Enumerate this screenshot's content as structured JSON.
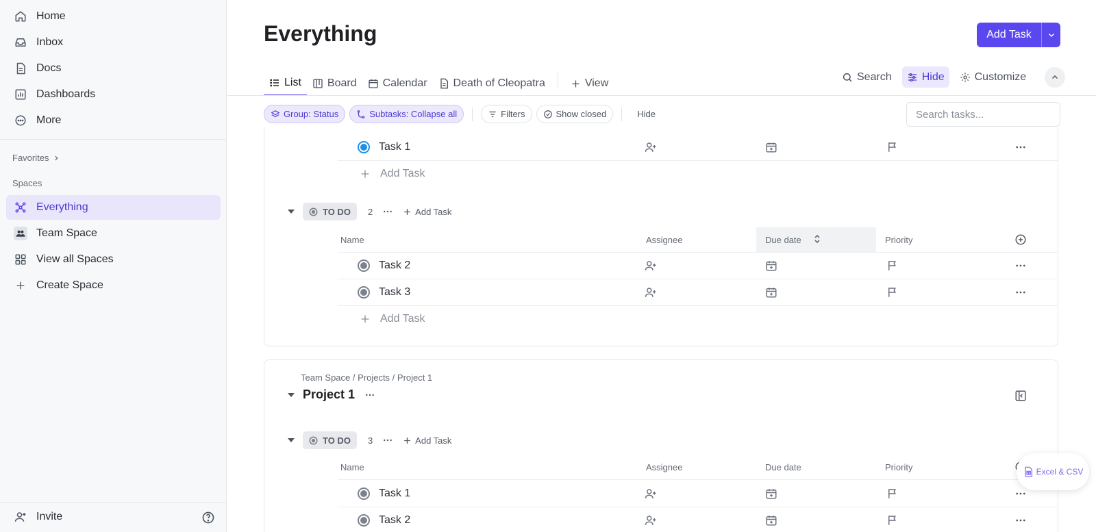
{
  "sidebar": {
    "nav": [
      {
        "label": "Home",
        "icon": "home-icon"
      },
      {
        "label": "Inbox",
        "icon": "inbox-icon"
      },
      {
        "label": "Docs",
        "icon": "docs-icon"
      },
      {
        "label": "Dashboards",
        "icon": "dashboards-icon"
      },
      {
        "label": "More",
        "icon": "more-circle-icon"
      }
    ],
    "favorites_label": "Favorites",
    "spaces_label": "Spaces",
    "spaces": [
      {
        "label": "Everything",
        "icon": "everything-icon",
        "active": true
      },
      {
        "label": "Team Space",
        "icon": "team-icon"
      },
      {
        "label": "View all Spaces",
        "icon": "grid-icon"
      },
      {
        "label": "Create Space",
        "icon": "plus-icon"
      }
    ],
    "invite_label": "Invite"
  },
  "header": {
    "title": "Everything",
    "add_task_label": "Add Task"
  },
  "tabs": [
    {
      "label": "List",
      "active": true
    },
    {
      "label": "Board"
    },
    {
      "label": "Calendar"
    },
    {
      "label": "Death of Cleopatra"
    },
    {
      "label": "View"
    }
  ],
  "tools": {
    "search": "Search",
    "hide": "Hide",
    "customize": "Customize"
  },
  "filterbar": {
    "group": "Group: Status",
    "subtasks": "Subtasks: Collapse all",
    "filters": "Filters",
    "show_closed": "Show closed",
    "hide": "Hide",
    "search_placeholder": "Search tasks..."
  },
  "columns": {
    "name": "Name",
    "assignee": "Assignee",
    "due": "Due date",
    "priority": "Priority"
  },
  "card1": {
    "top_task": "Task 1",
    "add_task": "Add Task",
    "group": {
      "status": "TO DO",
      "count": "2",
      "add_task": "Add Task"
    },
    "tasks": [
      "Task 2",
      "Task 3"
    ],
    "add_task_bottom": "Add Task"
  },
  "card2": {
    "breadcrumb": "Team Space / Projects / Project 1",
    "title": "Project 1",
    "group": {
      "status": "TO DO",
      "count": "3",
      "add_task": "Add Task"
    },
    "tasks": [
      "Task 1",
      "Task 2"
    ]
  },
  "export_label": "Excel & CSV",
  "colors": {
    "accent": "#5b47f0",
    "active_bg": "#e9e6fc",
    "status_selected": "#1e90e8"
  }
}
